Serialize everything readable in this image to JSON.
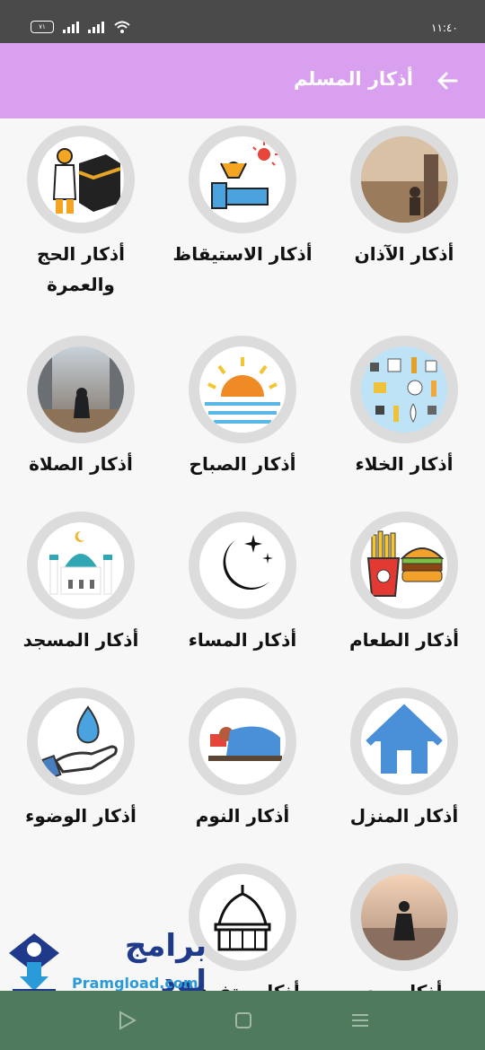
{
  "status_bar": {
    "time": "١١:٤٠",
    "battery": "٧١"
  },
  "app_bar": {
    "title": "أذكار المسلم",
    "back_icon": "arrow-back-icon"
  },
  "categories": [
    {
      "label": "أذكار الآذان",
      "icon": "mosque-minaret-photo"
    },
    {
      "label": "أذكار الاستيقاظ",
      "icon": "waking-up-icon"
    },
    {
      "label": "أذكار الحج والعمرة",
      "icon": "kaaba-pilgrim-icon"
    },
    {
      "label": "أذكار الخلاء",
      "icon": "toiletries-icon"
    },
    {
      "label": "أذكار الصباح",
      "icon": "sunrise-icon"
    },
    {
      "label": "أذكار الصلاة",
      "icon": "prayer-photo"
    },
    {
      "label": "أذكار الطعام",
      "icon": "fast-food-icon"
    },
    {
      "label": "أذكار المساء",
      "icon": "moon-stars-icon"
    },
    {
      "label": "أذكار المسجد",
      "icon": "mosque-icon"
    },
    {
      "label": "أذكار المنزل",
      "icon": "house-icon"
    },
    {
      "label": "أذكار النوم",
      "icon": "sleeping-icon"
    },
    {
      "label": "أذكار الوضوء",
      "icon": "water-drop-hand-icon"
    },
    {
      "label": "أذكار بعد",
      "icon": "praying-man-photo"
    },
    {
      "label": "أذكار متفرقة",
      "icon": "dome-outline-icon"
    }
  ],
  "watermark": {
    "text": "برامج لود",
    "url": "Pramgload.com"
  },
  "nav_bar": {
    "icons": [
      "back-triangle-icon",
      "home-square-icon",
      "recents-menu-icon"
    ]
  },
  "colors": {
    "app_bar": "#d8a0ee",
    "status_bar": "#4a4a4a",
    "nav_bar": "#4f7a5c",
    "circle_ring": "#dcdcdc"
  }
}
